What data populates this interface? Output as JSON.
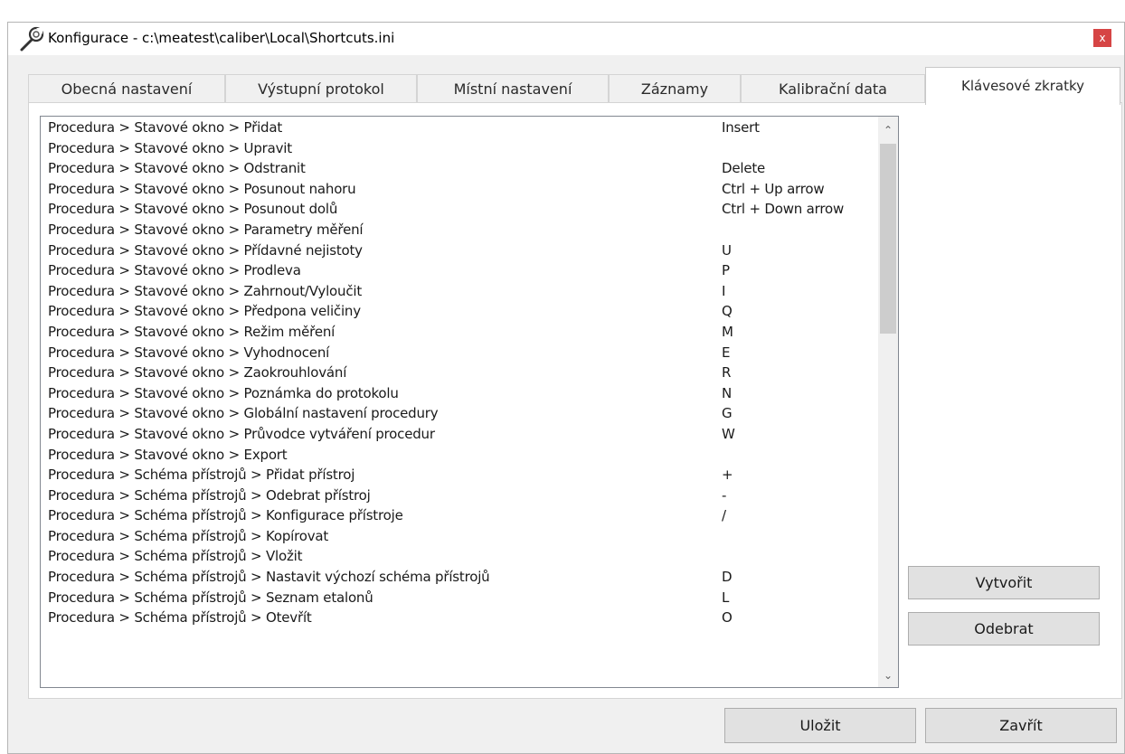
{
  "window": {
    "title": "Konfigurace - c:\\meatest\\caliber\\Local\\Shortcuts.ini",
    "close_label": "x"
  },
  "tabs": [
    {
      "label": "Obecná nastavení"
    },
    {
      "label": "Výstupní protokol"
    },
    {
      "label": "Místní nastavení"
    },
    {
      "label": "Záznamy"
    },
    {
      "label": "Kalibrační data"
    },
    {
      "label": "Klávesové zkratky",
      "active": true
    }
  ],
  "shortcuts": [
    {
      "command": "Procedura > Stavové okno > Přidat",
      "key": "Insert"
    },
    {
      "command": "Procedura > Stavové okno > Upravit",
      "key": ""
    },
    {
      "command": "Procedura > Stavové okno > Odstranit",
      "key": "Delete"
    },
    {
      "command": "Procedura > Stavové okno > Posunout nahoru",
      "key": "Ctrl + Up arrow"
    },
    {
      "command": "Procedura > Stavové okno > Posunout dolů",
      "key": "Ctrl + Down arrow"
    },
    {
      "command": "Procedura > Stavové okno > Parametry měření",
      "key": ""
    },
    {
      "command": "Procedura > Stavové okno > Přídavné nejistoty",
      "key": "U"
    },
    {
      "command": "Procedura > Stavové okno > Prodleva",
      "key": "P"
    },
    {
      "command": "Procedura > Stavové okno > Zahrnout/Vyloučit",
      "key": "I"
    },
    {
      "command": "Procedura > Stavové okno > Předpona veličiny",
      "key": "Q"
    },
    {
      "command": "Procedura > Stavové okno > Režim měření",
      "key": "M"
    },
    {
      "command": "Procedura > Stavové okno > Vyhodnocení",
      "key": "E"
    },
    {
      "command": "Procedura > Stavové okno > Zaokrouhlování",
      "key": "R"
    },
    {
      "command": "Procedura > Stavové okno > Poznámka do protokolu",
      "key": "N"
    },
    {
      "command": "Procedura > Stavové okno > Globální nastavení procedury",
      "key": "G"
    },
    {
      "command": "Procedura > Stavové okno > Průvodce vytváření procedur",
      "key": "W"
    },
    {
      "command": "Procedura > Stavové okno > Export",
      "key": ""
    },
    {
      "command": "Procedura > Schéma přístrojů > Přidat přístroj",
      "key": "+"
    },
    {
      "command": "Procedura > Schéma přístrojů > Odebrat přístroj",
      "key": "-"
    },
    {
      "command": "Procedura > Schéma přístrojů > Konfigurace přístroje",
      "key": "/"
    },
    {
      "command": "Procedura > Schéma přístrojů > Kopírovat",
      "key": ""
    },
    {
      "command": "Procedura > Schéma přístrojů > Vložit",
      "key": ""
    },
    {
      "command": "Procedura > Schéma přístrojů > Nastavit výchozí schéma přístrojů",
      "key": "D"
    },
    {
      "command": "Procedura > Schéma přístrojů > Seznam etalonů",
      "key": "L"
    },
    {
      "command": "Procedura > Schéma přístrojů > Otevřít",
      "key": "O"
    }
  ],
  "scrollbar": {
    "up_glyph": "⌃",
    "down_glyph": "⌄"
  },
  "buttons": {
    "create": "Vytvořit",
    "remove": "Odebrat",
    "save": "Uložit",
    "close": "Zavřít"
  },
  "icons": {
    "app": "wrench-icon"
  },
  "colors": {
    "close_button": "#d64545",
    "button_face": "#e1e1e1",
    "window_bg": "#f0f0f0"
  }
}
